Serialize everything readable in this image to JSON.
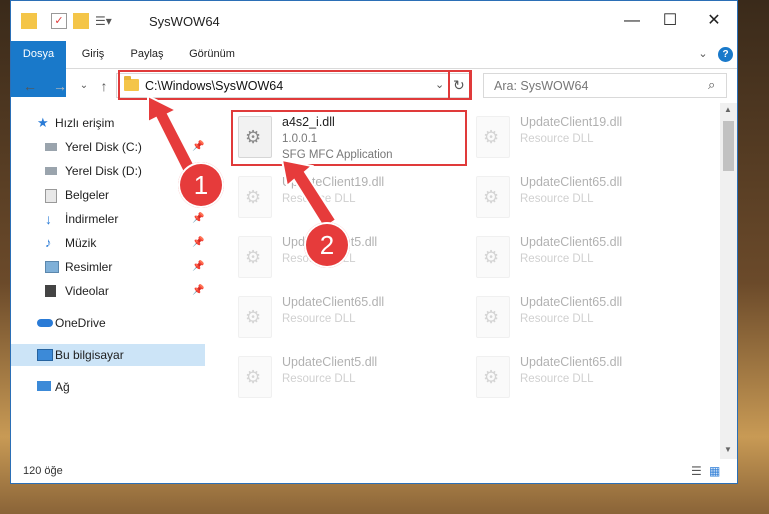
{
  "window": {
    "title": "SysWOW64",
    "controls": {
      "minimize": "—",
      "maximize": "☐",
      "close": "✕"
    }
  },
  "ribbon": {
    "tabs": [
      "Dosya",
      "Giriş",
      "Paylaş",
      "Görünüm"
    ],
    "help": "?",
    "expand": "⌄"
  },
  "address": {
    "path": "C:\\Windows\\SysWOW64",
    "search_placeholder": "Ara: SysWOW64"
  },
  "sidebar": {
    "items": [
      {
        "label": "Hızlı erişim",
        "icon": "star-icon"
      },
      {
        "label": "Yerel Disk (C:)",
        "icon": "drive-icon",
        "pinned": true
      },
      {
        "label": "Yerel Disk (D:)",
        "icon": "drive-icon"
      },
      {
        "label": "Belgeler",
        "icon": "documents-icon"
      },
      {
        "label": "İndirmeler",
        "icon": "download-icon",
        "pinned": true
      },
      {
        "label": "Müzik",
        "icon": "music-icon",
        "pinned": true
      },
      {
        "label": "Resimler",
        "icon": "pictures-icon",
        "pinned": true
      },
      {
        "label": "Videolar",
        "icon": "video-icon",
        "pinned": true
      },
      {
        "label": "OneDrive",
        "icon": "cloud-icon"
      },
      {
        "label": "Bu bilgisayar",
        "icon": "computer-icon",
        "selected": true
      },
      {
        "label": "Ağ",
        "icon": "network-icon"
      }
    ]
  },
  "files": [
    {
      "name": "a4s2_i.dll",
      "line2": "1.0.0.1",
      "line3": "SFG MFC Application"
    },
    {
      "name": "UpdateClient19.dll",
      "line2": "Resource DLL"
    },
    {
      "name": "UpdateClient19.dll",
      "line2": "Resource DLL"
    },
    {
      "name": "UpdateClient65.dll",
      "line2": "Resource DLL"
    },
    {
      "name": "UpdateClient5.dll",
      "line2": "Resource DLL"
    },
    {
      "name": "UpdateClient65.dll",
      "line2": "Resource DLL"
    },
    {
      "name": "UpdateClient65.dll",
      "line2": "Resource DLL"
    },
    {
      "name": "UpdateClient65.dll",
      "line2": "Resource DLL"
    },
    {
      "name": "UpdateClient5.dll",
      "line2": "Resource DLL"
    },
    {
      "name": "UpdateClient65.dll",
      "line2": "Resource DLL"
    }
  ],
  "status": {
    "count": "120 öğe"
  },
  "annotations": {
    "step1": "1",
    "step2": "2",
    "color": "#e63b3b"
  }
}
